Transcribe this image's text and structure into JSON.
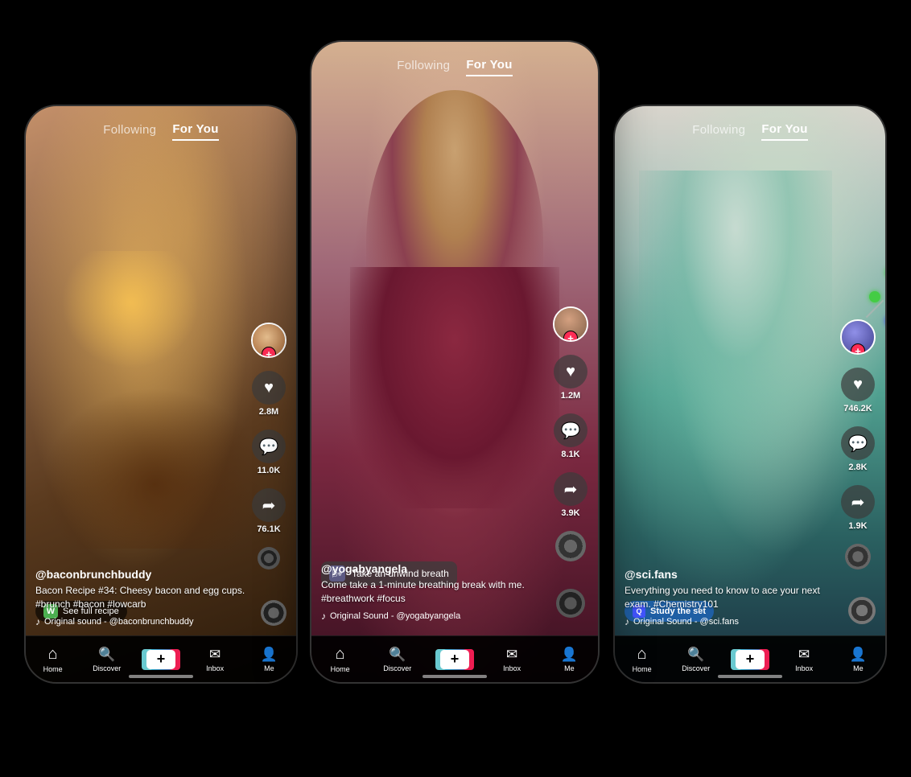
{
  "phones": {
    "left": {
      "nav": {
        "following": "Following",
        "for_you": "For You",
        "active": "for_you"
      },
      "actions": {
        "likes": "2.8M",
        "comments": "11.0K",
        "shares": "76.1K"
      },
      "banner": {
        "icon": "W",
        "text": "See full recipe"
      },
      "user": "@baconbrunchbuddy",
      "description": "Bacon Recipe #34: Cheesy bacon and egg cups. #brunch #bacon #lowcarb",
      "music": "Original sound - @baconbrunchbuddy",
      "bottom_nav": {
        "home": "Home",
        "discover": "Discover",
        "inbox": "Inbox",
        "me": "Me"
      }
    },
    "center": {
      "nav": {
        "following": "Following",
        "for_you": "For You",
        "active": "for_you"
      },
      "actions": {
        "likes": "1.2M",
        "comments": "8.1K",
        "shares": "3.9K"
      },
      "breathing": {
        "icon": "🌬",
        "text": "Take an unwind breath"
      },
      "user": "@yogabyangela",
      "description": "Come take a 1-minute breathing break with me. #breathwork #focus",
      "music": "Original Sound - @yogabyangela",
      "bottom_nav": {
        "home": "Home",
        "discover": "Discover",
        "inbox": "Inbox",
        "me": "Me"
      }
    },
    "right": {
      "nav": {
        "following": "Following",
        "for_you": "For You",
        "active": "for_you"
      },
      "actions": {
        "likes": "746.2K",
        "comments": "2.8K",
        "shares": "1.9K"
      },
      "study": {
        "icon": "Q",
        "text": "Study the set"
      },
      "user": "@sci.fans",
      "description": "Everything you need to know to ace your next exam. #Chemistry101",
      "music": "Original Sound - @sci.fans",
      "bottom_nav": {
        "home": "Home",
        "discover": "Discover",
        "inbox": "Inbox",
        "me": "Me"
      }
    }
  }
}
